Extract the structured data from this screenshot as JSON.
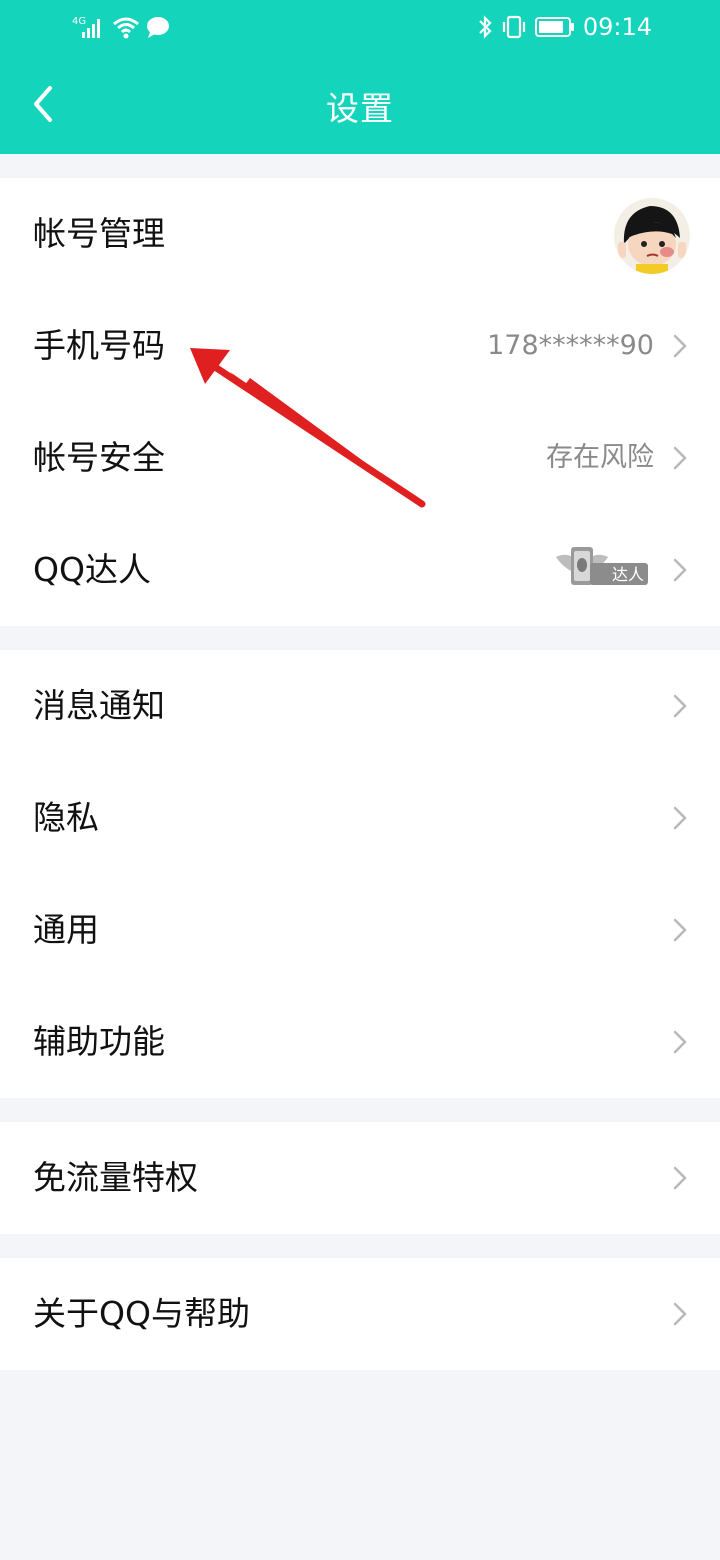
{
  "status_bar": {
    "time": "09:14",
    "network": "4G",
    "icons": [
      "signal-icon",
      "wifi-icon",
      "chat-bubble-icon",
      "bluetooth-icon",
      "vibrate-icon",
      "battery-icon"
    ]
  },
  "header": {
    "title": "设置",
    "back_icon": "back-chevron-icon"
  },
  "groups": [
    {
      "items": [
        {
          "label": "帐号管理",
          "value": "",
          "accessory": "avatar"
        },
        {
          "label": "手机号码",
          "value": "178******90",
          "accessory": "chevron"
        },
        {
          "label": "帐号安全",
          "value": "存在风险",
          "accessory": "chevron"
        },
        {
          "label": "QQ达人",
          "value": "",
          "accessory": "badge-chevron",
          "badge_text": "达人"
        }
      ]
    },
    {
      "items": [
        {
          "label": "消息通知",
          "accessory": "chevron"
        },
        {
          "label": "隐私",
          "accessory": "chevron"
        },
        {
          "label": "通用",
          "accessory": "chevron"
        },
        {
          "label": "辅助功能",
          "accessory": "chevron"
        }
      ]
    },
    {
      "items": [
        {
          "label": "免流量特权",
          "accessory": "chevron"
        }
      ]
    },
    {
      "items": [
        {
          "label": "关于QQ与帮助",
          "accessory": "chevron"
        }
      ]
    }
  ],
  "colors": {
    "header": "#14d4bc",
    "background": "#f4f5f9",
    "annotation_arrow": "#e02020"
  }
}
